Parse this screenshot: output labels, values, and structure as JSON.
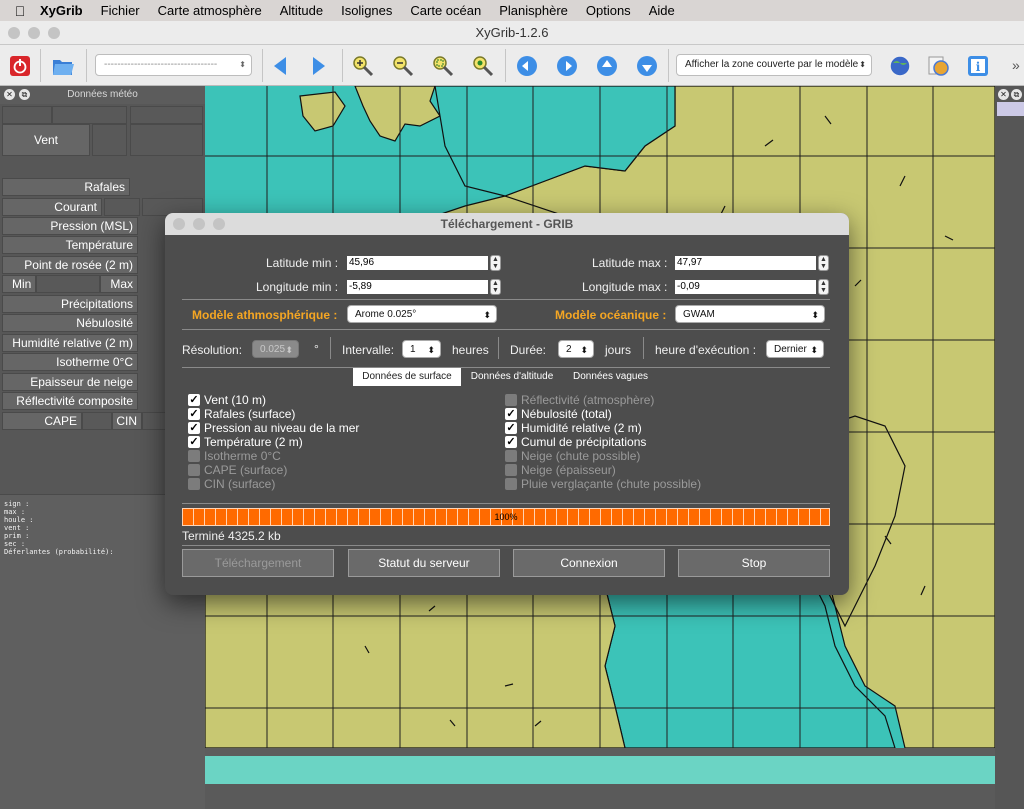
{
  "menubar": {
    "app": "XyGrib",
    "items": [
      "Fichier",
      "Carte atmosphère",
      "Altitude",
      "Isolignes",
      "Carte océan",
      "Planisphère",
      "Options",
      "Aide"
    ]
  },
  "window": {
    "title": "XyGrib-1.2.6"
  },
  "toolbar": {
    "file_combo": "----------------------------------",
    "zone_combo": "Afficher la zone couverte par le modèle"
  },
  "left_panel": {
    "title": "Données météo",
    "rows": {
      "vent": "Vent",
      "rafales": "Rafales",
      "courant": "Courant",
      "pression": "Pression (MSL)",
      "temperature": "Température",
      "rosee": "Point de rosée (2 m)",
      "min": "Min",
      "max": "Max",
      "precip": "Précipitations",
      "nebulosite": "Nébulosité",
      "humidite": "Humidité relative (2 m)",
      "isotherme": "Isotherme 0°C",
      "neige": "Epaisseur de neige",
      "reflectivite": "Réflectivité composite",
      "cape": "CAPE",
      "cin": "CIN"
    },
    "info_text": "sign :\nmax :\nhoule :\nvent :\nprim :\nsec :\nDéferlantes (probabilité):"
  },
  "dialog": {
    "title": "Téléchargement - GRIB",
    "lat_min_label": "Latitude min :",
    "lat_min": "45,96",
    "lat_max_label": "Latitude max :",
    "lat_max": "47,97",
    "lon_min_label": "Longitude min :",
    "lon_min": "-5,89",
    "lon_max_label": "Longitude max :",
    "lon_max": "-0,09",
    "atmo_model_label": "Modèle athmosphérique :",
    "atmo_model": "Arome 0.025°",
    "ocean_model_label": "Modèle océanique :",
    "ocean_model": "GWAM",
    "resolution_label": "Résolution:",
    "resolution": "0.025",
    "degree": "°",
    "interval_label": "Intervalle:",
    "interval": "1",
    "hours": "heures",
    "duration_label": "Durée:",
    "duration": "2",
    "days": "jours",
    "run_label": "heure d'exécution :",
    "run": "Dernier",
    "tabs": [
      "Données de surface",
      "Données d'altitude",
      "Données vagues"
    ],
    "left_checks": [
      {
        "label": "Vent (10 m)",
        "checked": true,
        "enabled": true
      },
      {
        "label": "Rafales (surface)",
        "checked": true,
        "enabled": true
      },
      {
        "label": "Pression au niveau de la mer",
        "checked": true,
        "enabled": true
      },
      {
        "label": "Température (2 m)",
        "checked": true,
        "enabled": true
      },
      {
        "label": "Isotherme 0°C",
        "checked": false,
        "enabled": false
      },
      {
        "label": "CAPE (surface)",
        "checked": false,
        "enabled": false
      },
      {
        "label": "CIN (surface)",
        "checked": false,
        "enabled": false
      }
    ],
    "right_checks": [
      {
        "label": "Réflectivité (atmosphère)",
        "checked": false,
        "enabled": false
      },
      {
        "label": "Nébulosité (total)",
        "checked": true,
        "enabled": true
      },
      {
        "label": "Humidité relative (2 m)",
        "checked": true,
        "enabled": true
      },
      {
        "label": "Cumul de précipitations",
        "checked": true,
        "enabled": true
      },
      {
        "label": "Neige (chute possible)",
        "checked": false,
        "enabled": false
      },
      {
        "label": "Neige (épaisseur)",
        "checked": false,
        "enabled": false
      },
      {
        "label": "Pluie verglaçante (chute possible)",
        "checked": false,
        "enabled": false
      }
    ],
    "progress_text": "100%",
    "progress": 1.0,
    "status": "Terminé 4325.2 kb",
    "buttons": {
      "download": "Téléchargement",
      "server": "Statut du serveur",
      "connect": "Connexion",
      "stop": "Stop"
    }
  },
  "colors": {
    "sea": "#3cc3b8",
    "land": "#c8c872",
    "accent_orange": "#f5a623",
    "progress": "#ff6a00"
  }
}
